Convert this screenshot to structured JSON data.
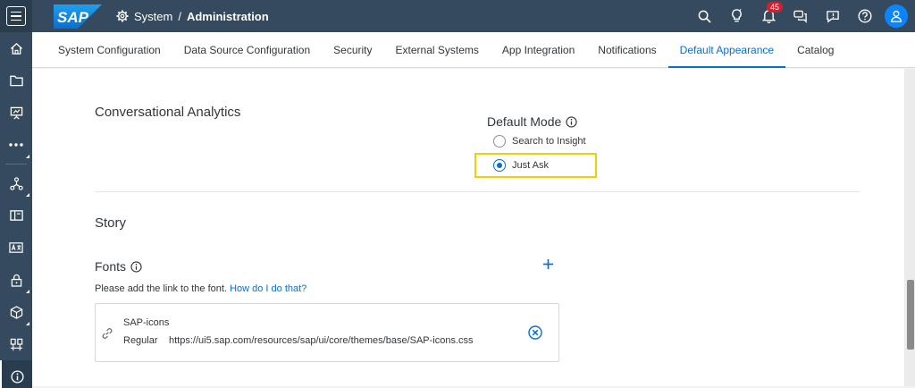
{
  "shell": {
    "logo_text": "SAP",
    "title_prefix": "System",
    "title_separator": "/",
    "title_main": "Administration",
    "notification_count": "45",
    "icons": [
      "search-icon",
      "lightbulb-icon",
      "bell-icon",
      "chat-icon",
      "feedback-icon",
      "help-icon",
      "user-avatar-icon"
    ],
    "colors": {
      "bar": "#354a5f",
      "accent": "#0a6ed1",
      "badge": "#d32030",
      "highlight": "#f0d000"
    }
  },
  "leftnav": {
    "icons": [
      "home-icon",
      "folder-icon",
      "presentation-icon",
      "more-icon",
      "network-icon",
      "book-icon",
      "translate-icon",
      "lock-icon",
      "cube-icon",
      "monitor-icon",
      "info-icon"
    ]
  },
  "tabs": [
    {
      "label": "System Configuration"
    },
    {
      "label": "Data Source Configuration"
    },
    {
      "label": "Security"
    },
    {
      "label": "External Systems"
    },
    {
      "label": "App Integration"
    },
    {
      "label": "Notifications"
    },
    {
      "label": "Default Appearance"
    },
    {
      "label": "Catalog"
    }
  ],
  "active_tab": "Default Appearance",
  "conversational": {
    "title": "Conversational Analytics",
    "mode_label": "Default Mode",
    "options": [
      {
        "label": "Search to Insight",
        "selected": false
      },
      {
        "label": "Just Ask",
        "selected": true
      }
    ]
  },
  "story": {
    "title": "Story",
    "fonts_label": "Fonts",
    "hint_text": "Please add the link to the font.",
    "hint_link": "How do I do that?",
    "font_entry": {
      "name": "SAP-icons",
      "weight": "Regular",
      "url": "https://ui5.sap.com/resources/sap/ui/core/themes/base/SAP-icons.css"
    }
  }
}
